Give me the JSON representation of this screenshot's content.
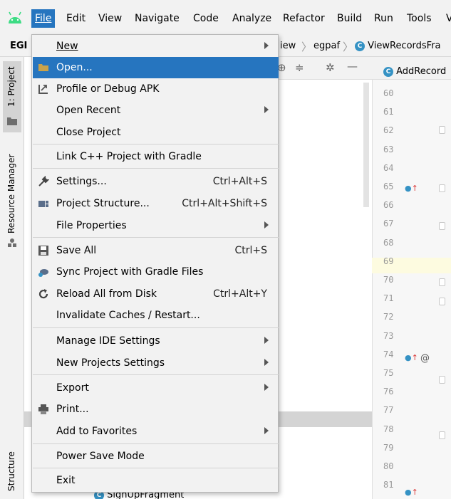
{
  "menubar": {
    "items": [
      {
        "label": "File",
        "mnemonic": "F"
      },
      {
        "label": "Edit",
        "mnemonic": "E"
      },
      {
        "label": "View",
        "mnemonic": "V"
      },
      {
        "label": "Navigate",
        "mnemonic": "N"
      },
      {
        "label": "Code",
        "mnemonic": "C"
      },
      {
        "label": "Analyze",
        "mnemonic": "z"
      },
      {
        "label": "Refactor",
        "mnemonic": "R"
      },
      {
        "label": "Build",
        "mnemonic": "B"
      },
      {
        "label": "Run",
        "mnemonic": "u"
      },
      {
        "label": "Tools",
        "mnemonic": "T"
      },
      {
        "label": "V",
        "mnemonic": ""
      }
    ]
  },
  "navbar": {
    "project_short": "EGI",
    "crumbs": [
      "iew",
      "egpaf",
      "ViewRecordsFra"
    ]
  },
  "left_strip": {
    "project_tab": "1: Project",
    "resource_tab": "Resource Manager",
    "structure_tab": "Structure"
  },
  "project_panel": {
    "visible_item": "SignUpFragment"
  },
  "editor": {
    "tab_label": "AddRecord",
    "line_numbers": [
      "60",
      "61",
      "62",
      "63",
      "64",
      "65",
      "66",
      "67",
      "68",
      "69",
      "70",
      "71",
      "72",
      "73",
      "74",
      "75",
      "76",
      "77",
      "78",
      "79",
      "80",
      "81"
    ],
    "annotation_at": "@"
  },
  "file_menu": {
    "items": [
      {
        "label": "New",
        "mnemonic_char": "N",
        "submenu": true
      },
      {
        "label": "Open...",
        "selected": true,
        "icon": "folder-icon"
      },
      {
        "label": "Profile or Debug APK",
        "icon": "profile-apk-icon"
      },
      {
        "label": "Open Recent",
        "submenu": true
      },
      {
        "label": "Close Project"
      },
      {
        "label": "Link C++ Project with Gradle"
      },
      {
        "label": "Settings...",
        "shortcut": "Ctrl+Alt+S",
        "icon": "wrench-icon"
      },
      {
        "label": "Project Structure...",
        "shortcut": "Ctrl+Alt+Shift+S",
        "icon": "project-structure-icon"
      },
      {
        "label": "File Properties",
        "submenu": true
      },
      {
        "label": "Save All",
        "shortcut": "Ctrl+S",
        "icon": "save-icon"
      },
      {
        "label": "Sync Project with Gradle Files",
        "icon": "gradle-sync-icon"
      },
      {
        "label": "Reload All from Disk",
        "shortcut": "Ctrl+Alt+Y",
        "icon": "reload-icon"
      },
      {
        "label": "Invalidate Caches / Restart..."
      },
      {
        "label": "Manage IDE Settings",
        "submenu": true
      },
      {
        "label": "New Projects Settings",
        "submenu": true
      },
      {
        "label": "Export",
        "submenu": true
      },
      {
        "label": "Print...",
        "icon": "print-icon"
      },
      {
        "label": "Add to Favorites",
        "submenu": true
      },
      {
        "label": "Power Save Mode"
      },
      {
        "label": "Exit"
      }
    ]
  },
  "colors": {
    "selection": "#2675bf",
    "menu_bg": "#f2f2f2",
    "class_badge": "#3592c4",
    "android_green": "#3ddc84"
  }
}
